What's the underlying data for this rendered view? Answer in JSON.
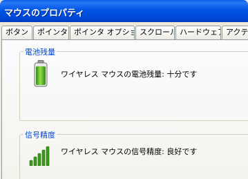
{
  "window": {
    "title": "マウスのプロパティ"
  },
  "tabs": [
    {
      "label": "ボタン"
    },
    {
      "label": "ポインタ"
    },
    {
      "label": "ポインタ オプション"
    },
    {
      "label": "スクロール"
    },
    {
      "label": "ハードウェア"
    },
    {
      "label": "アクティ"
    }
  ],
  "battery": {
    "group_label": "電池残量",
    "status": "ワイヤレス マウスの電池残量: 十分です",
    "icon": "battery-full-icon",
    "level": 1.0,
    "color": "#3aa010"
  },
  "signal": {
    "group_label": "信号精度",
    "status": "ワイヤレス マウスの信号精度: 良好です",
    "icon": "signal-strength-icon",
    "bars": 5,
    "color": "#3a9a1a"
  },
  "colors": {
    "titlebar": "#0055e5",
    "group_label": "#0046d5",
    "window_bg": "#ece9d8"
  }
}
